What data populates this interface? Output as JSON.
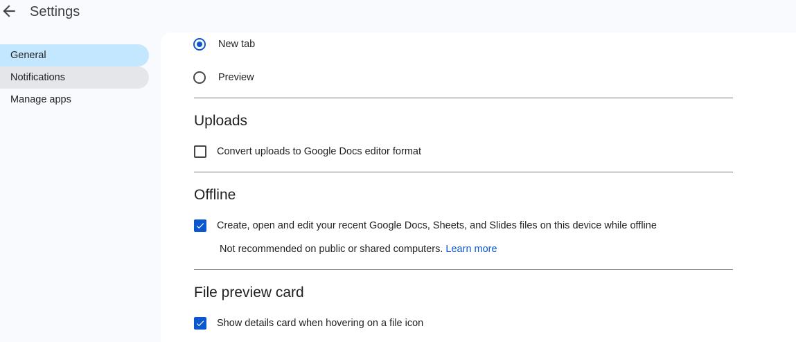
{
  "header": {
    "back_icon": "arrow-back-icon",
    "title": "Settings"
  },
  "sidebar": {
    "items": [
      {
        "label": "General",
        "state": "selected"
      },
      {
        "label": "Notifications",
        "state": "hovered"
      },
      {
        "label": "Manage apps",
        "state": "normal"
      }
    ]
  },
  "main": {
    "open_options": [
      {
        "label": "New tab",
        "checked": true
      },
      {
        "label": "Preview",
        "checked": false
      }
    ],
    "uploads": {
      "title": "Uploads",
      "convert_label": "Convert uploads to Google Docs editor format",
      "convert_checked": false
    },
    "offline": {
      "title": "Offline",
      "enable_label": "Create, open and edit your recent Google Docs, Sheets, and Slides files on this device while offline",
      "enable_checked": true,
      "note": "Not recommended on public or shared computers.",
      "learn_more": "Learn more"
    },
    "file_preview": {
      "title": "File preview card",
      "show_label": "Show details card when hovering on a file icon",
      "show_checked": true
    }
  },
  "colors": {
    "accent": "#0b57d0",
    "nav_selected_bg": "#c2e7ff",
    "nav_hover_bg": "#e5e6e9",
    "page_bg": "#f8fafd",
    "panel_bg": "#ffffff"
  }
}
